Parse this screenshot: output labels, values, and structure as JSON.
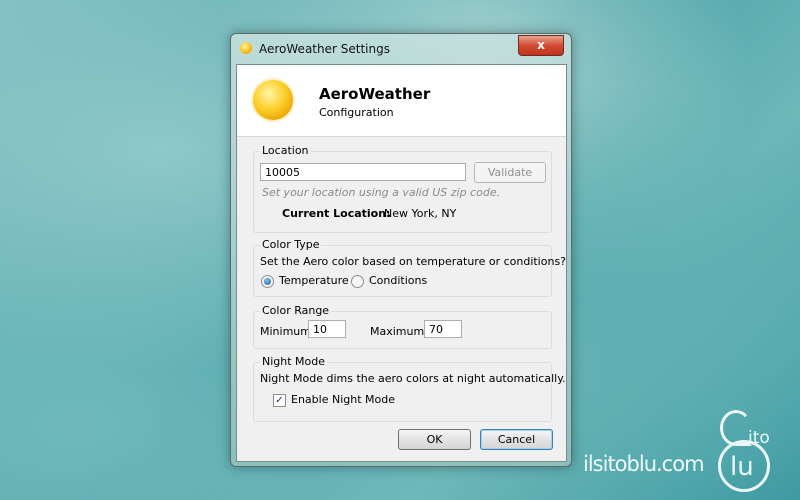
{
  "window": {
    "title": "AeroWeather Settings",
    "close_label": "x",
    "close_color": "#c7402a"
  },
  "header": {
    "app_name": "AeroWeather",
    "subtitle": "Configuration",
    "icon": "sun-icon"
  },
  "location": {
    "legend": "Location",
    "zip_value": "10005",
    "validate_label": "Validate",
    "hint": "Set your location using a valid US zip code.",
    "current_label": "Current Location:",
    "current_value": "New York, NY"
  },
  "color_type": {
    "legend": "Color Type",
    "description": "Set the Aero color based on temperature or conditions?",
    "options": [
      "Temperature",
      "Conditions"
    ],
    "selected": "Temperature"
  },
  "color_range": {
    "legend": "Color Range",
    "min_label": "Minimum:",
    "min_value": "10",
    "max_label": "Maximum:",
    "max_value": "70"
  },
  "night_mode": {
    "legend": "Night Mode",
    "description": "Night Mode dims the aero colors at night automatically.",
    "checkbox_label": "Enable Night Mode",
    "checked": true
  },
  "buttons": {
    "ok": "OK",
    "cancel": "Cancel"
  },
  "watermark": {
    "text": "ilsitoblu.com",
    "logo_top": "ito",
    "logo_bottom": "lu"
  }
}
